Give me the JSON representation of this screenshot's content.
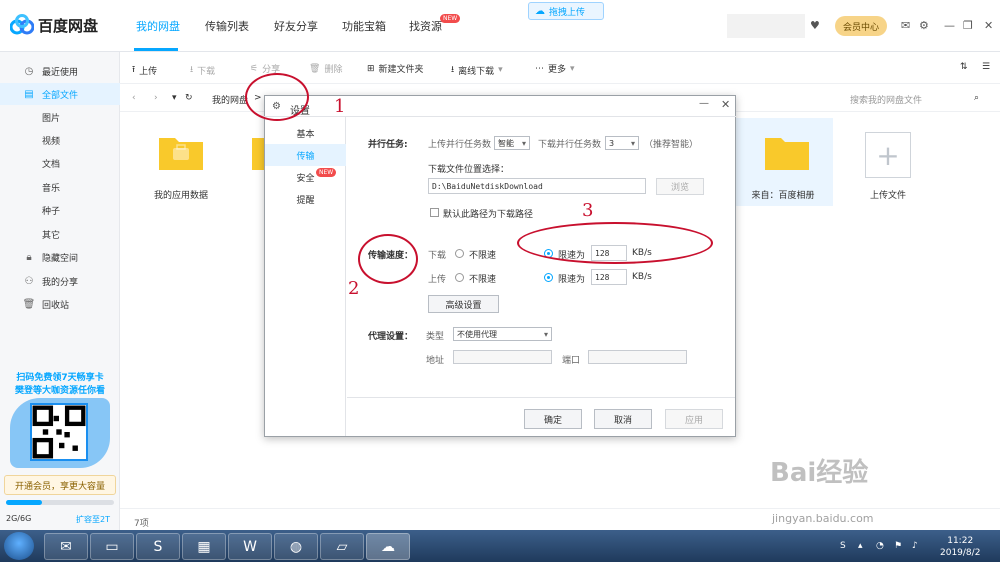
{
  "app": {
    "logo_text": "百度网盘",
    "nav_tabs": [
      "我的网盘",
      "传输列表",
      "好友分享",
      "功能宝箱",
      "找资源"
    ],
    "new_badge": "NEW",
    "drag_upload": "拖拽上传",
    "vip_button": "会员中心"
  },
  "sidebar": {
    "items": [
      {
        "icon": "clock-icon",
        "label": "最近使用"
      },
      {
        "icon": "file-icon",
        "label": "全部文件"
      },
      {
        "label": "图片"
      },
      {
        "label": "视频"
      },
      {
        "label": "文档"
      },
      {
        "label": "音乐"
      },
      {
        "label": "种子"
      },
      {
        "label": "其它"
      },
      {
        "icon": "lock-icon",
        "label": "隐藏空间"
      },
      {
        "icon": "share-icon",
        "label": "我的分享"
      },
      {
        "icon": "trash-icon",
        "label": "回收站"
      }
    ],
    "promo_line1": "扫码免费领7天畅享卡",
    "promo_line2": "樊登等大咖资源任你看",
    "vip_promo": "开通会员，享更大容量",
    "quota": "2G/6G",
    "quota_fraction": 0.33,
    "expand": "扩容至2T"
  },
  "toolbar": {
    "upload": "上传",
    "download": "下载",
    "share": "分享",
    "delete": "删除",
    "new_folder": "新建文件夹",
    "offline_download": "离线下载",
    "more": "更多"
  },
  "pathbar": {
    "path": "我的网盘",
    "search_placeholder": "搜索我的网盘文件"
  },
  "files": [
    {
      "name": "我的应用数据"
    },
    {
      "name": "来自：百度相册"
    },
    {
      "name": "上传文件"
    }
  ],
  "status": {
    "count": "7项"
  },
  "dialog": {
    "title": "设置",
    "nav": [
      "基本",
      "传输",
      "安全",
      "提醒"
    ],
    "nav_new_badge": "NEW",
    "parallel": {
      "label": "并行任务:",
      "upload_label": "上传并行任务数",
      "upload_value": "智能",
      "download_label": "下载并行任务数",
      "download_value": "3",
      "hint": "（推荐智能）"
    },
    "download_location": {
      "label": "下载文件位置选择：",
      "path": "D:\\BaiduNetdiskDownload",
      "browse": "浏览",
      "default_checkbox": "默认此路径为下载路径"
    },
    "speed": {
      "label": "传输速度：",
      "download": "下载",
      "upload": "上传",
      "unlimited": "不限速",
      "limit_to": "限速为",
      "download_limit": "128",
      "upload_limit": "128",
      "unit": "KB/s",
      "advanced": "高级设置"
    },
    "proxy": {
      "label": "代理设置：",
      "type_label": "类型",
      "type_value": "不使用代理",
      "address_label": "地址",
      "port_label": "端口"
    },
    "buttons": {
      "ok": "确定",
      "cancel": "取消",
      "apply": "应用"
    }
  },
  "annotations": [
    "1",
    "2",
    "3"
  ],
  "taskbar": {
    "time": "11:22",
    "date": "2019/8/2"
  },
  "watermark": {
    "text": "Bai经验",
    "sub": "jingyan.baidu.com"
  },
  "colors": {
    "accent": "#06a7ff",
    "annotation": "#c8102e",
    "folder": "#f9c92b"
  }
}
